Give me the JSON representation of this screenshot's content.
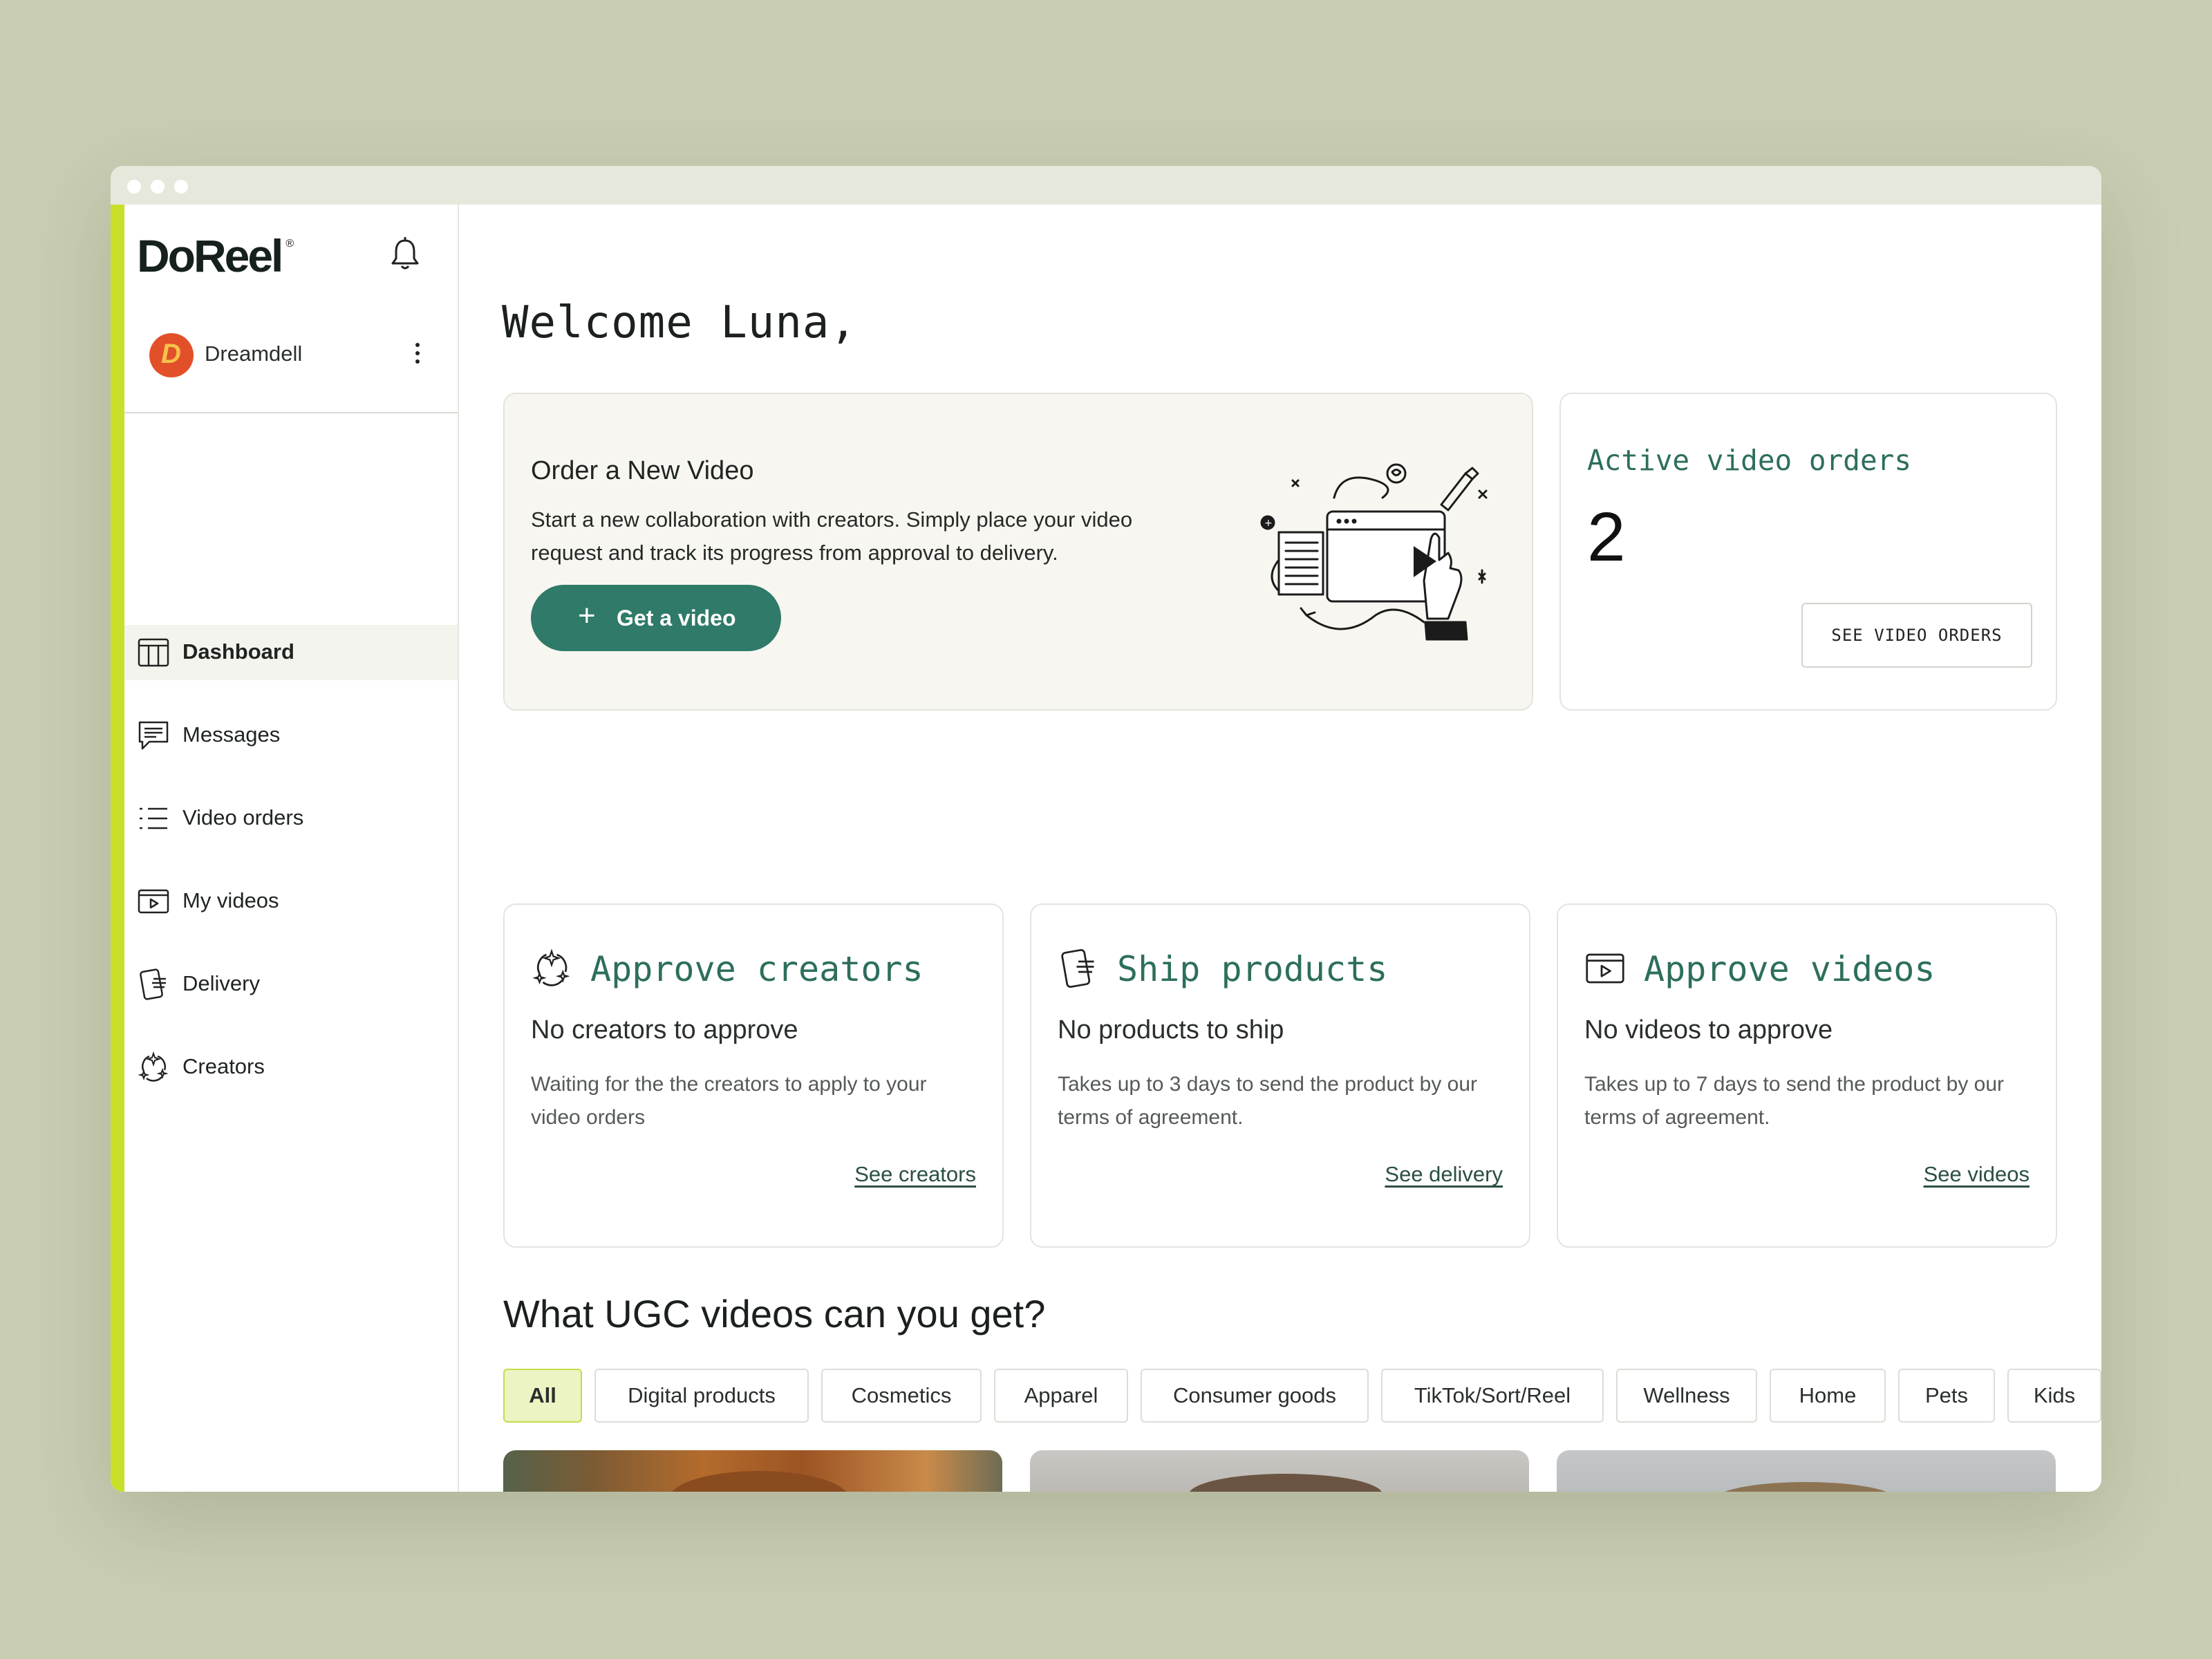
{
  "app": {
    "logo": "DoReel",
    "logo_mark": "®",
    "company": {
      "name": "Dreamdell",
      "initial": "D"
    }
  },
  "sidebar": {
    "items": [
      {
        "label": "Dashboard",
        "icon": "dashboard-icon",
        "active": true
      },
      {
        "label": "Messages",
        "icon": "messages-icon",
        "active": false
      },
      {
        "label": "Video orders",
        "icon": "list-icon",
        "active": false
      },
      {
        "label": "My videos",
        "icon": "video-icon",
        "active": false
      },
      {
        "label": "Delivery",
        "icon": "delivery-icon",
        "active": false
      },
      {
        "label": "Creators",
        "icon": "creators-icon",
        "active": false
      }
    ]
  },
  "main": {
    "welcome": "Welcome Luna,",
    "order_card": {
      "title": "Order a New Video",
      "description": "Start a new collaboration with creators. Simply place your video request and track its progress from approval to delivery.",
      "button_label": "Get a video"
    },
    "active_orders": {
      "title": "Active video orders",
      "count": "2",
      "button_label": "SEE VIDEO ORDERS"
    },
    "tasks": [
      {
        "title": "Approve creators",
        "icon": "creators-icon",
        "subtitle": "No creators to approve",
        "description": "Waiting for the the creators to apply to your video orders",
        "link": "See creators"
      },
      {
        "title": "Ship products",
        "icon": "delivery-icon",
        "subtitle": "No products to ship",
        "description": "Takes up to 3 days to send the product by our terms of agreement.",
        "link": "See delivery"
      },
      {
        "title": "Approve videos",
        "icon": "video-icon",
        "subtitle": "No videos to approve",
        "description": "Takes up to 7 days to send the product by our terms of agreement.",
        "link": "See videos"
      }
    ],
    "ugc_heading": "What UGC videos can you get?",
    "categories": [
      "All",
      "Digital products",
      "Cosmetics",
      "Apparel",
      "Consumer goods",
      "TikTok/Sort/Reel",
      "Wellness",
      "Home",
      "Pets",
      "Kids"
    ],
    "selected_category": "All"
  },
  "colors": {
    "accent_green": "#2f7a68",
    "lime_strip": "#c8e02a",
    "chip_active_bg": "#ecf4c4",
    "background": "#c9cdb3"
  }
}
